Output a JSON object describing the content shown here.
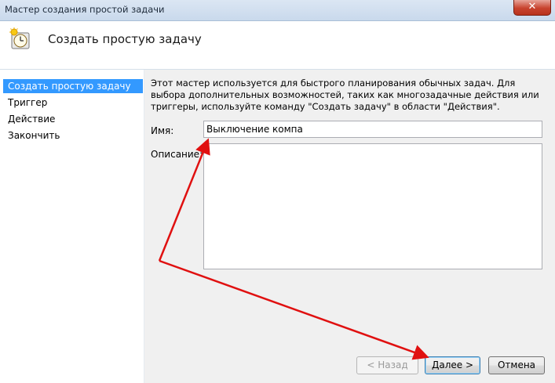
{
  "window": {
    "title": "Мастер создания простой задачи",
    "close_glyph": "✕"
  },
  "header": {
    "title": "Создать простую задачу",
    "icon": "clock-sun-icon"
  },
  "steps": [
    {
      "label": "Создать простую задачу",
      "selected": true
    },
    {
      "label": "Триггер",
      "selected": false
    },
    {
      "label": "Действие",
      "selected": false
    },
    {
      "label": "Закончить",
      "selected": false
    }
  ],
  "main": {
    "description": "Этот мастер используется для быстрого планирования обычных задач.  Для выбора дополнительных возможностей, таких как многозадачные действия или триггеры, используйте команду \"Создать задачу\" в области \"Действия\".",
    "name_label": "Имя:",
    "name_value": "Выключение компа",
    "description_label": "Описание:",
    "description_value": ""
  },
  "buttons": {
    "back": "< Назад",
    "next": "Далее >",
    "cancel": "Отмена"
  },
  "colors": {
    "selection": "#3399ff",
    "annotation_arrow": "#e01010"
  }
}
